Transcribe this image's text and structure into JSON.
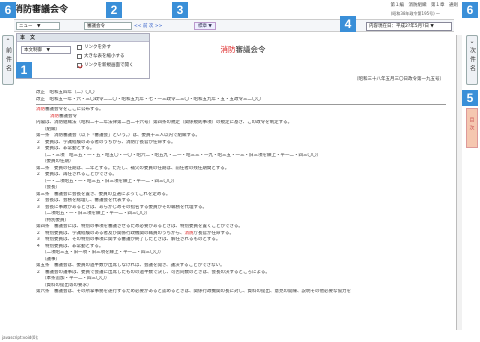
{
  "header": {
    "title": "消防審議会令",
    "right_text": "第１編　消防組織　第１章　通則",
    "law_ref": "(昭和38年政令第195号) 〜"
  },
  "toolbar": {
    "select_value": "ニュー　▼",
    "search_value": "審議会令",
    "nav_links": "<< 前 次 >>",
    "mark_btn": "標章 ▼",
    "date_label": "内容現在日：",
    "date_value": "平成2?年5月?日 ▼"
  },
  "dropdown": {
    "header": "本　文",
    "select_value": "本文制御　▼",
    "options": [
      {
        "label": "リンクを外す",
        "checked": false
      },
      {
        "label": "大きな表を縮小する",
        "checked": false
      },
      {
        "label": "リンクを新規画面で開く",
        "checked": true
      }
    ]
  },
  "left_nav": {
    "prev_doc": "前件名"
  },
  "right_nav": {
    "next_doc": "次件名",
    "toc": "目次"
  },
  "callouts": [
    "1",
    "2",
    "3",
    "4",
    "5",
    "6",
    "6"
  ],
  "main": {
    "title_prefix": "消防",
    "title_rest": "審議会令",
    "number": "〔昭和三十八年五月三〇日政令第一九五号〕",
    "lines": [
      {
        "t": "改正　昭和五四年（二）〇〇",
        "c": ""
      },
      {
        "t": "改正　昭和五一年・六・三〇政令二二〇・昭和五九年・七・一三政令二三〇・昭和五九年・五・五政令三二〇〇",
        "c": ""
      },
      {
        "t": "",
        "c": "sep"
      },
      {
        "t": "消防審議会令をここに公布する。",
        "c": "",
        "hl": "消防"
      },
      {
        "t": "消防審議会令",
        "c": "indent2",
        "hl": "消防"
      },
      {
        "t": "内閣は、消防組織法（昭和二十二年法律第二百二十六号）第四条の規定（関係規則事項）の規定に基き、この政令を制定する。",
        "c": ""
      },
      {
        "t": "（組織）",
        "c": "indent1"
      },
      {
        "t": "第一条　消防審議会（以下「審議会」という。）は、委員十三人以内で組織する。",
        "c": ""
      },
      {
        "t": "２　委員は、学識経験のある者のうちから、消防庁長官が任命する。",
        "c": ""
      },
      {
        "t": "３　委員は、非常勤とする。",
        "c": ""
      },
      {
        "t": "（二・三項　昭三五・一・五・昭五〇・一〇・昭六二・昭五九・二一・昭三三・一九・昭三五・一三・旧三項を繰上・平一二・四三〇〇）",
        "c": "indent1"
      },
      {
        "t": "（委員の任期）",
        "c": "indent1"
      },
      {
        "t": "第二条　委員の任期は、二年とする。ただし、補欠の委員の任期は、前任者の残任期間とする。",
        "c": ""
      },
      {
        "t": "２　委員は、再任されることができる。",
        "c": ""
      },
      {
        "t": "（一・二項昭五・一・昭三五・旧三項を繰上・平一二・四三〇〇）",
        "c": "indent1"
      },
      {
        "t": "（会長）",
        "c": "indent1"
      },
      {
        "t": "第三条　審議会に会長を置き、委員の互選によってこれを定める。",
        "c": ""
      },
      {
        "t": "２　会長は、会務を総理し、審議会を代表する。",
        "c": ""
      },
      {
        "t": "３　会長に事故があるときは、あらかじめその指名する委員がその職務を代理する。",
        "c": ""
      },
      {
        "t": "（二項昭五・一・旧三項を繰上・平一二・四三〇〇）",
        "c": "indent1"
      },
      {
        "t": "（特別委員）",
        "c": "indent1"
      },
      {
        "t": "第四条　審議会には、特別の事項を審議させるため必要があるときは、特別委員を置くことができる。",
        "c": ""
      },
      {
        "t": "２　特別委員は、学識経験のある者及び関係行政機関の職員のうちから、消防庁長官が任命する。",
        "c": "",
        "hl": "消防"
      },
      {
        "t": "３　特別委員は、その特別の事項に関する審議が終了したときは、解任されるものとする。",
        "c": ""
      },
      {
        "t": "４　特別委員は、非常勤とする。",
        "c": ""
      },
      {
        "t": "（二項昭三五・旧一項・旧三項を繰上・平一二・四三〇〇）",
        "c": "indent1"
      },
      {
        "t": "（議事）",
        "c": "indent1"
      },
      {
        "t": "第五条　審議会は、委員の過半数が出席しなければ、会議を開き、議決することができない。",
        "c": ""
      },
      {
        "t": "２　審議会の議事は、委員で会議に出席したものの過半数で決し、可否同数のときは、会長の決するところによる。",
        "c": ""
      },
      {
        "t": "（本条追加・平一二・四三〇〇）",
        "c": "indent1"
      },
      {
        "t": "（資料の提出等の要求）",
        "c": "indent1"
      },
      {
        "t": "第六条　審議会は、その所掌事務を遂行するため必要があると認めるときは、関係行政機関の長に対し、資料の提出、意見の開陳、説明その他必要な協力を",
        "c": ""
      }
    ]
  },
  "status_bar": "javascript:void(0);"
}
